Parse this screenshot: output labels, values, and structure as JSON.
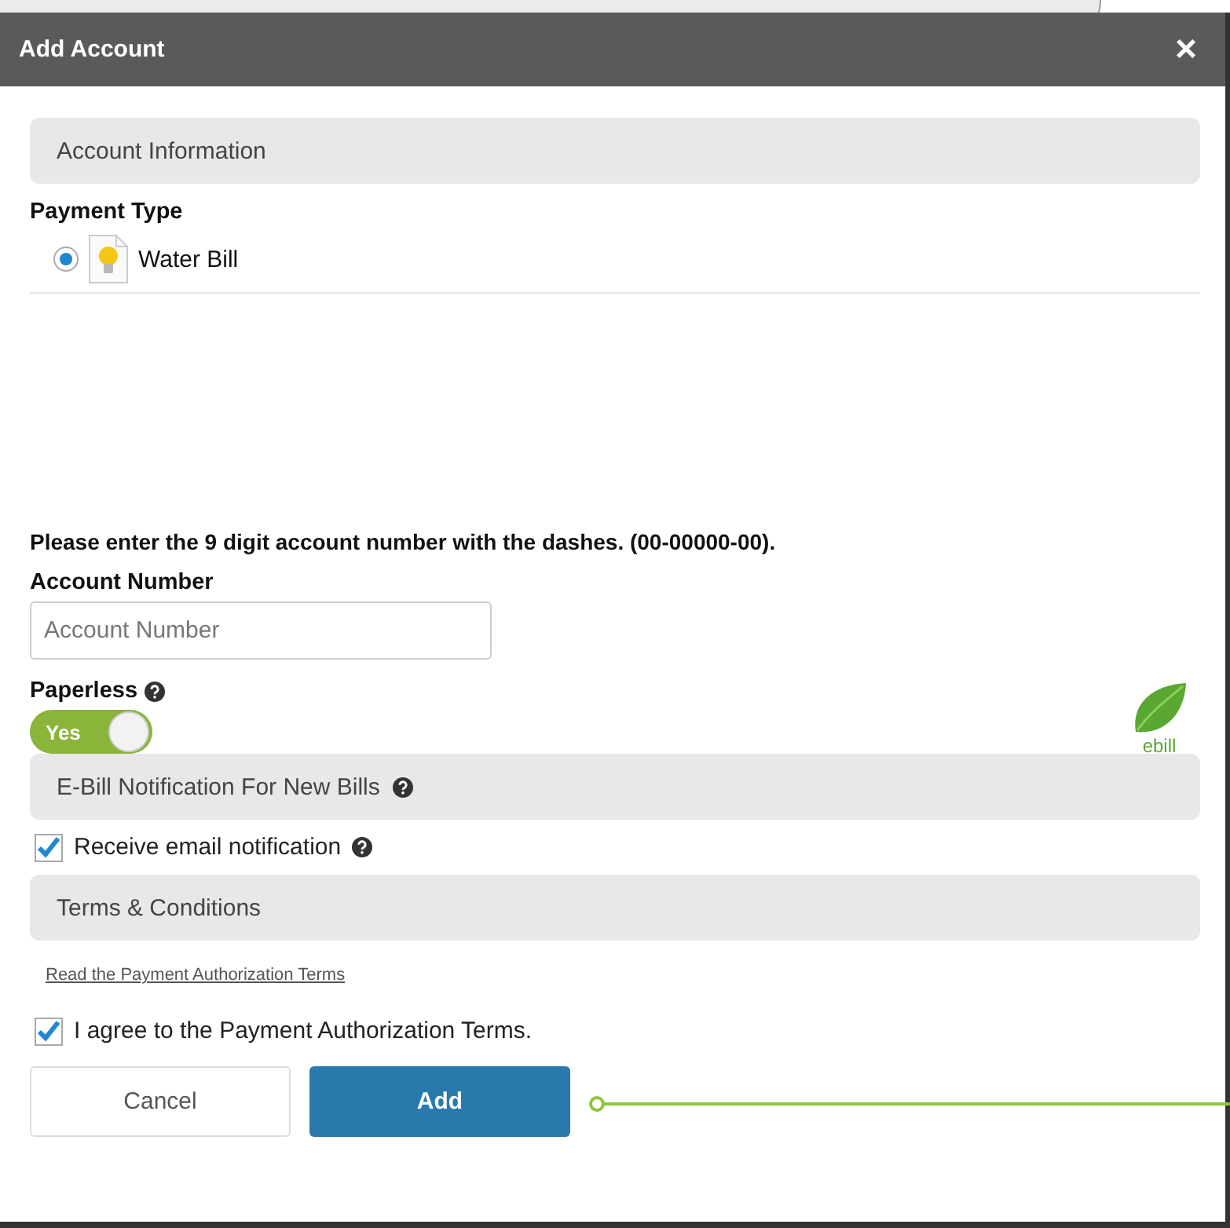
{
  "dialog": {
    "title": "Add Account",
    "close": "×"
  },
  "sections": {
    "account_information": "Account Information",
    "ebill_notification": "E-Bill Notification For New Bills",
    "terms": "Terms & Conditions"
  },
  "payment_type": {
    "label": "Payment Type",
    "options": [
      {
        "label": "Water Bill",
        "selected": true
      }
    ]
  },
  "instructions": "Please enter the 9 digit account number with the dashes. (00-00000-00).",
  "account_number": {
    "label": "Account Number",
    "placeholder": "Account Number"
  },
  "paperless": {
    "label": "Paperless",
    "toggle_text": "Yes",
    "on": true,
    "badge": "ebill"
  },
  "receive_email": {
    "label": "Receive email notification",
    "checked": true
  },
  "terms_link": "Read the Payment Authorization Terms",
  "agree": {
    "label": "I agree to the Payment Authorization Terms.",
    "checked": true
  },
  "buttons": [
    {
      "label": "Cancel",
      "kind": "secondary"
    },
    {
      "label": "Add",
      "kind": "primary"
    }
  ]
}
